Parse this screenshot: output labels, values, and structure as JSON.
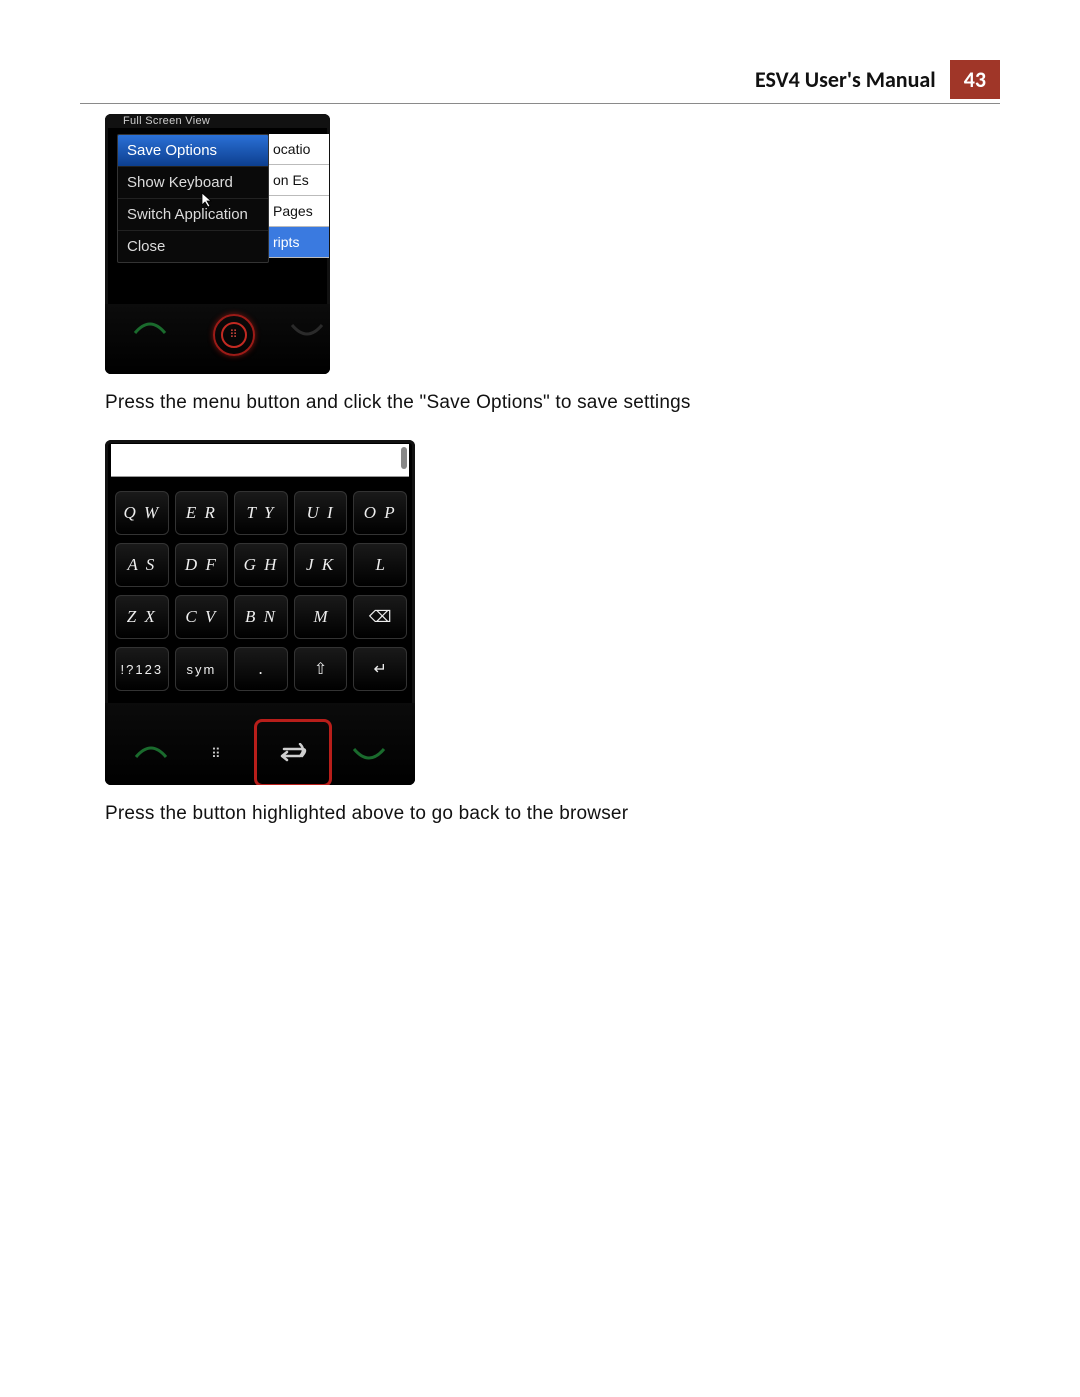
{
  "header": {
    "title": "ESV4 User's Manual",
    "page": "43"
  },
  "figure1": {
    "statusbar": "Full Screen View",
    "menu_items": [
      "Save Options",
      "Show Keyboard",
      "Switch Application",
      "Close"
    ],
    "selected_index": 0,
    "peek_rows": [
      "ocatio",
      "on Es",
      "Pages",
      "ripts"
    ]
  },
  "caption1": "Press the menu button and click the \"Save Options\" to save settings",
  "figure2": {
    "keyboard": {
      "row1": [
        "Q W",
        "E R",
        "T Y",
        "U I",
        "O P"
      ],
      "row2": [
        "A S",
        "D F",
        "G H",
        "J K",
        "L"
      ],
      "row3": [
        "Z X",
        "C V",
        "B N",
        "M",
        "⌫"
      ],
      "row4": [
        "!?123",
        "sym",
        ".",
        "⇧",
        "↵"
      ]
    }
  },
  "caption2": "Press the button highlighted above to go back to the browser"
}
